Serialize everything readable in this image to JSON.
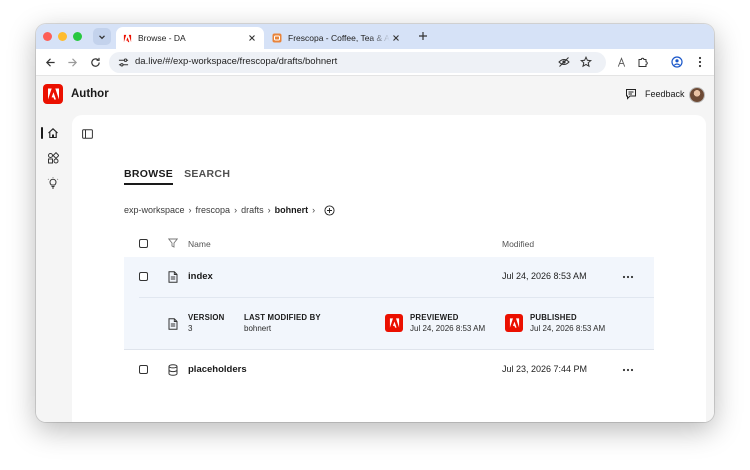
{
  "browser": {
    "tabs": [
      {
        "title": "Browse - DA",
        "active": true
      },
      {
        "title": "Frescopa - Coffee, Tea & Accessories",
        "active": false
      }
    ],
    "url": "da.live/#/exp-workspace/frescopa/drafts/bohnert"
  },
  "app": {
    "brand": "Author",
    "feedback_label": "Feedback",
    "accent_color": "#eb1000"
  },
  "main": {
    "tabs": [
      {
        "label": "BROWSE",
        "selected": true
      },
      {
        "label": "SEARCH",
        "selected": false
      }
    ],
    "breadcrumb": [
      "exp-workspace",
      "frescopa",
      "drafts",
      "bohnert"
    ],
    "columns": {
      "name": "Name",
      "modified": "Modified"
    },
    "rows": [
      {
        "name": "index",
        "modified": "Jul 24, 2026 8:53 AM",
        "icon": "document-icon",
        "expanded": true
      },
      {
        "name": "placeholders",
        "modified": "Jul 23, 2026 7:44 PM",
        "icon": "database-icon",
        "expanded": false
      }
    ],
    "details": {
      "version_label": "VERSION",
      "version_value": "3",
      "modified_by_label": "LAST MODIFIED BY",
      "modified_by_value": "bohnert",
      "previewed_label": "PREVIEWED",
      "previewed_value": "Jul 24, 2026 8:53 AM",
      "published_label": "PUBLISHED",
      "published_value": "Jul 24, 2026 8:53 AM"
    }
  }
}
